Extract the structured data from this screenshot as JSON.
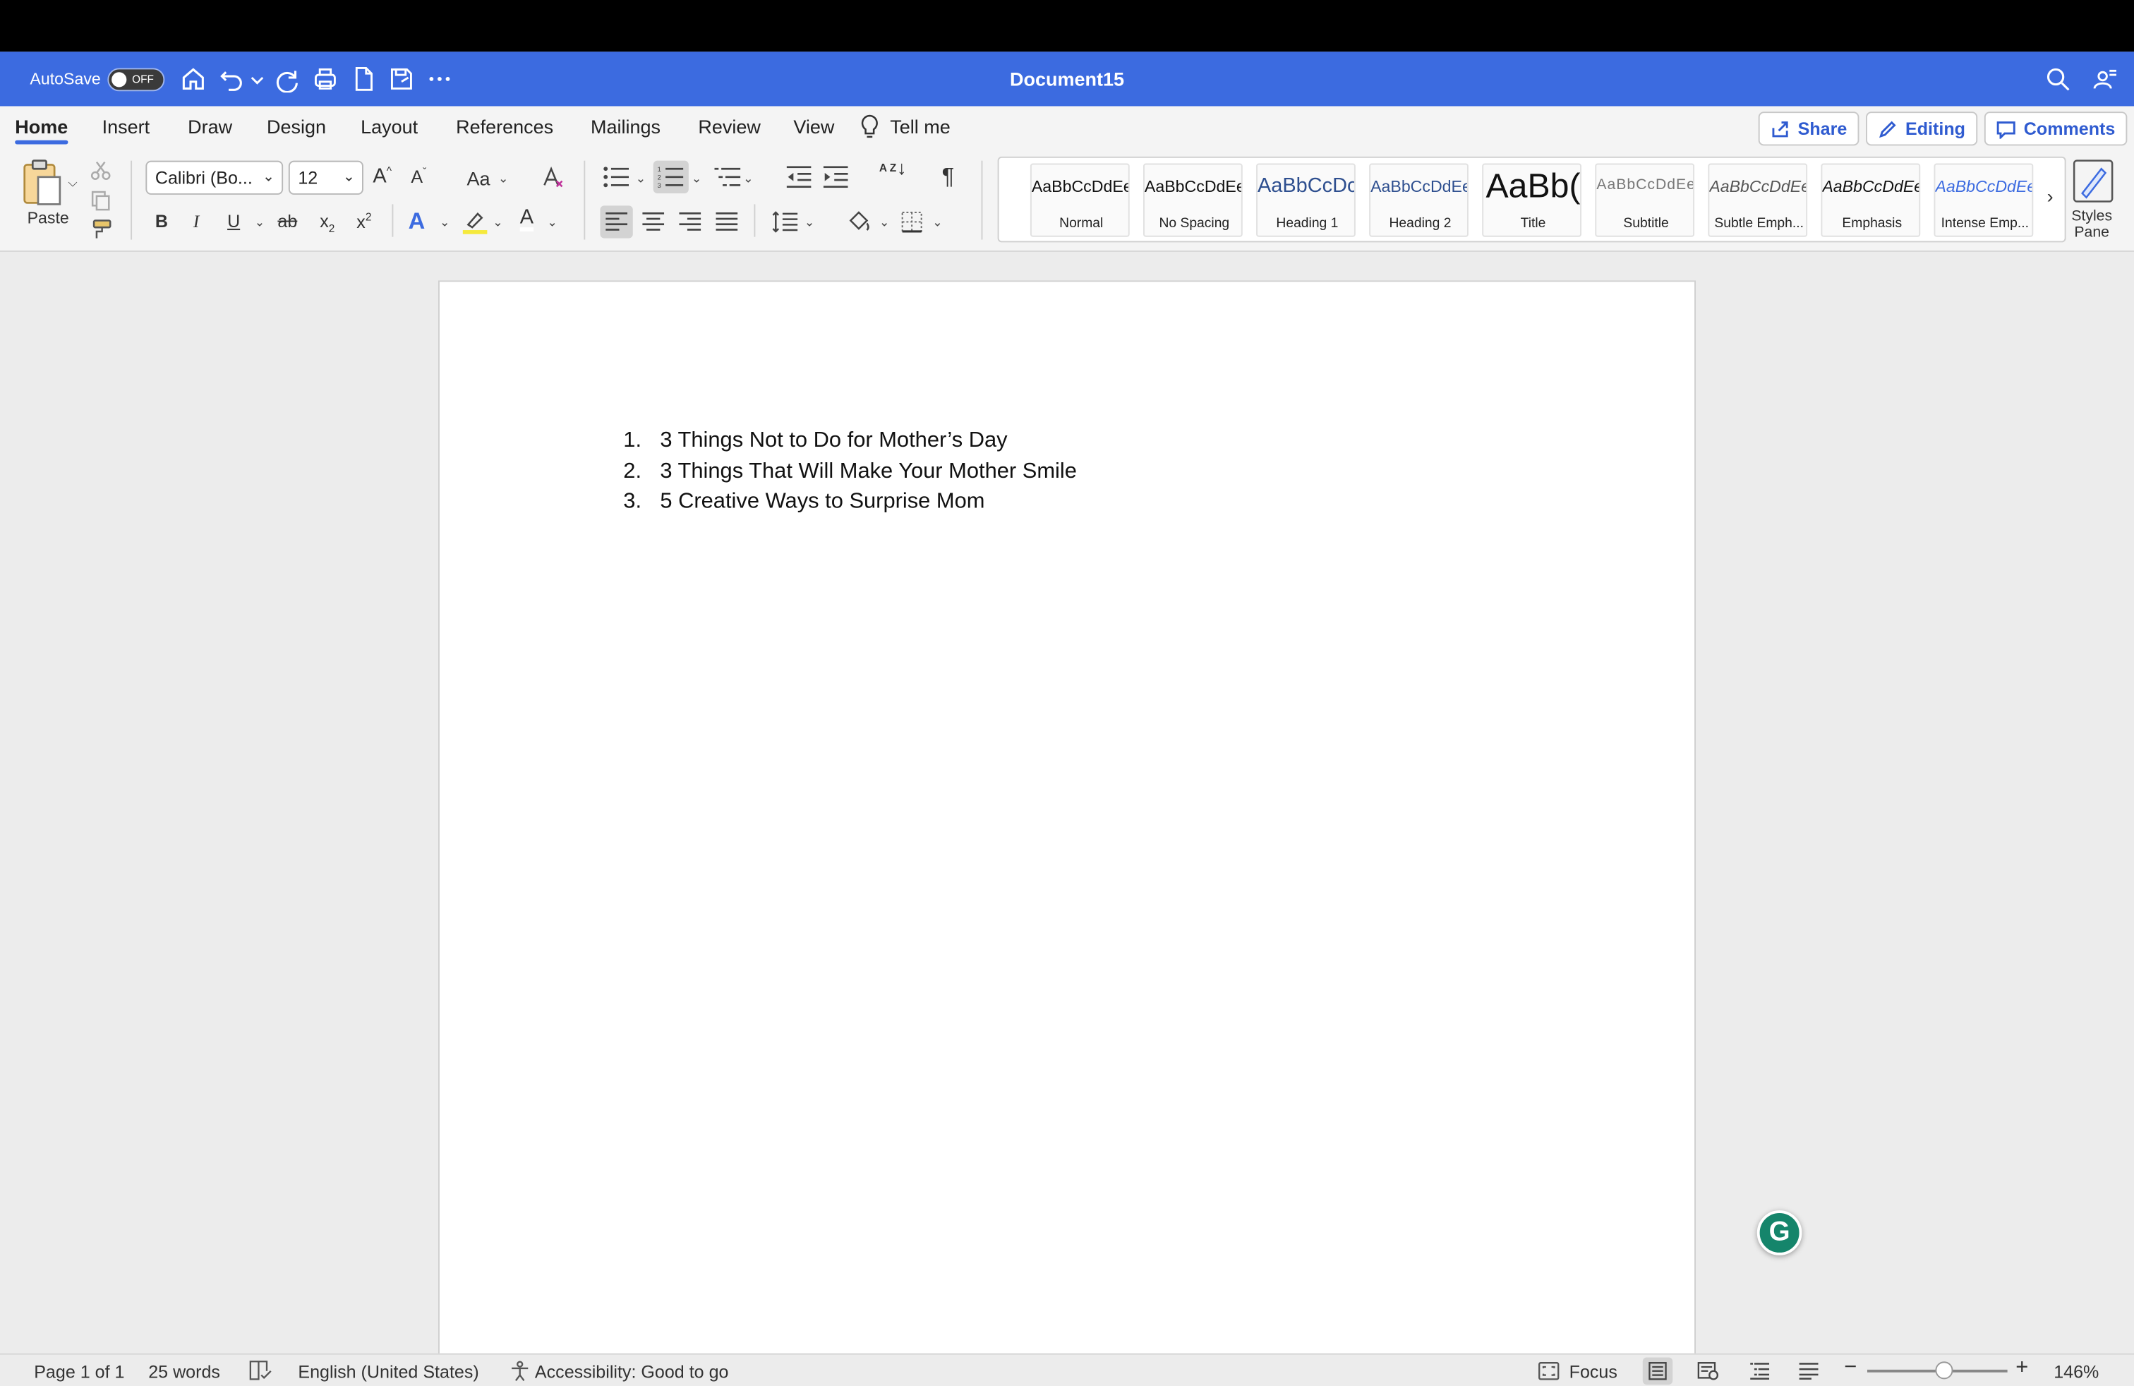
{
  "app": {
    "document_title": "Document15",
    "autosave_label": "AutoSave",
    "autosave_state": "OFF"
  },
  "tabs": [
    {
      "label": "Home",
      "active": true
    },
    {
      "label": "Insert"
    },
    {
      "label": "Draw"
    },
    {
      "label": "Design"
    },
    {
      "label": "Layout"
    },
    {
      "label": "References"
    },
    {
      "label": "Mailings"
    },
    {
      "label": "Review"
    },
    {
      "label": "View"
    },
    {
      "label": "Tell me"
    }
  ],
  "header_actions": {
    "share": "Share",
    "editing": "Editing",
    "comments": "Comments"
  },
  "ribbon": {
    "paste_label": "Paste",
    "font_name": "Calibri (Bo...",
    "font_size": "12",
    "change_case": "Aa",
    "bold": "B",
    "italic": "I",
    "underline": "U",
    "strikethrough": "ab",
    "subscript": "x",
    "superscript": "x",
    "sort": "A Z",
    "styles_pane_label_1": "Styles",
    "styles_pane_label_2": "Pane",
    "highlight_color": "#f5e93c",
    "font_color": "#ffffff",
    "text_effects_color": "#3c6be0"
  },
  "styles": [
    {
      "preview": "AaBbCcDdEe",
      "name": "Normal"
    },
    {
      "preview": "AaBbCcDdEe",
      "name": "No Spacing"
    },
    {
      "preview": "AaBbCcDc",
      "name": "Heading 1"
    },
    {
      "preview": "AaBbCcDdEe",
      "name": "Heading 2"
    },
    {
      "preview": "AaBb(",
      "name": "Title"
    },
    {
      "preview": "AaBbCcDdEe",
      "name": "Subtitle"
    },
    {
      "preview": "AaBbCcDdEe",
      "name": "Subtle Emph..."
    },
    {
      "preview": "AaBbCcDdEe",
      "name": "Emphasis"
    },
    {
      "preview": "AaBbCcDdEe",
      "name": "Intense Emp..."
    }
  ],
  "document": {
    "list": [
      {
        "num": "1.",
        "text": "3 Things Not to Do for Mother’s Day"
      },
      {
        "num": "2.",
        "text": "3 Things That Will Make Your Mother Smile"
      },
      {
        "num": "3.",
        "text": "5 Creative Ways to Surprise Mom"
      }
    ]
  },
  "grammarly_letter": "G",
  "status": {
    "page": "Page 1 of 1",
    "words": "25 words",
    "language": "English (United States)",
    "accessibility": "Accessibility: Good to go",
    "focus": "Focus",
    "zoom": "146%"
  },
  "colors": {
    "title_bar": "#3c6be0",
    "accent": "#2f5bd0",
    "grammarly": "#15856b"
  }
}
